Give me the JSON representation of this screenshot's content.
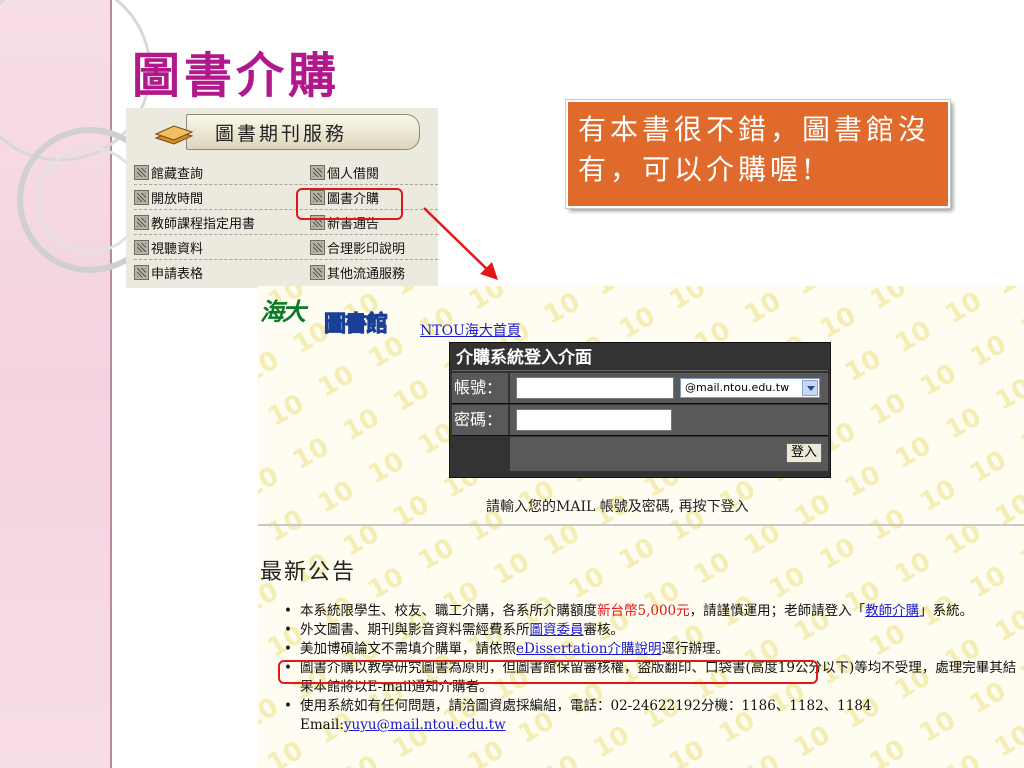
{
  "slide": {
    "title": "圖書介購",
    "callout": "有本書很不錯，圖書館沒有，可以介購喔!"
  },
  "service_menu": {
    "header": "圖書期刊服務",
    "items_left": [
      "館藏查詢",
      "開放時間",
      "教師課程指定用書",
      "視聽資料",
      "申請表格"
    ],
    "items_right": [
      "個人借閱",
      "圖書介購",
      "新書通告",
      "合理影印說明",
      "其他流通服務"
    ]
  },
  "webpage": {
    "logo_left": "海大",
    "logo_right": "圖書館",
    "home_link": "NTOU海大首頁",
    "login": {
      "title": "介購系統登入介面",
      "account_label": "帳號：",
      "password_label": "密碼：",
      "domain_option": "@mail.ntou.edu.tw",
      "submit": "登入"
    },
    "hint": "請輸入您的MAIL 帳號及密碼, 再按下登入",
    "news_title": "最新公告",
    "news": {
      "item1_a": "本系統限學生、校友、職工介購，各系所介購額度",
      "item1_amount": "新台幣5,000元",
      "item1_b": "，請謹慎運用；老師請登入「",
      "item1_link": "教師介購",
      "item1_c": "」系統。",
      "item2_a": "外文圖書、期刊與影音資料需經費系所",
      "item2_link": "圖資委員",
      "item2_b": "審核。",
      "item3_a": "美加博碩論文不需填介購單，請依照",
      "item3_link": "eDissertation介購說明",
      "item3_b": "逕行辦理。",
      "item4": "圖書介購以教學研究圖書為原則，但圖書館保留審核權，盜版翻印、口袋書(高度19公分以下)等均不受理，處理完畢其結果本館將以E-mail通知介購者。",
      "item5_a": "使用系統如有任何問題，請洽圖資處採編組，電話：02-24622192分機：1186、1182、1184",
      "item5_email_label": "Email:",
      "item5_email": "yuyu@mail.ntou.edu.tw"
    }
  },
  "colors": {
    "title": "#b0188c",
    "callout_bg": "#df6a2b",
    "highlight": "#e21818",
    "link": "#1a1acc"
  }
}
